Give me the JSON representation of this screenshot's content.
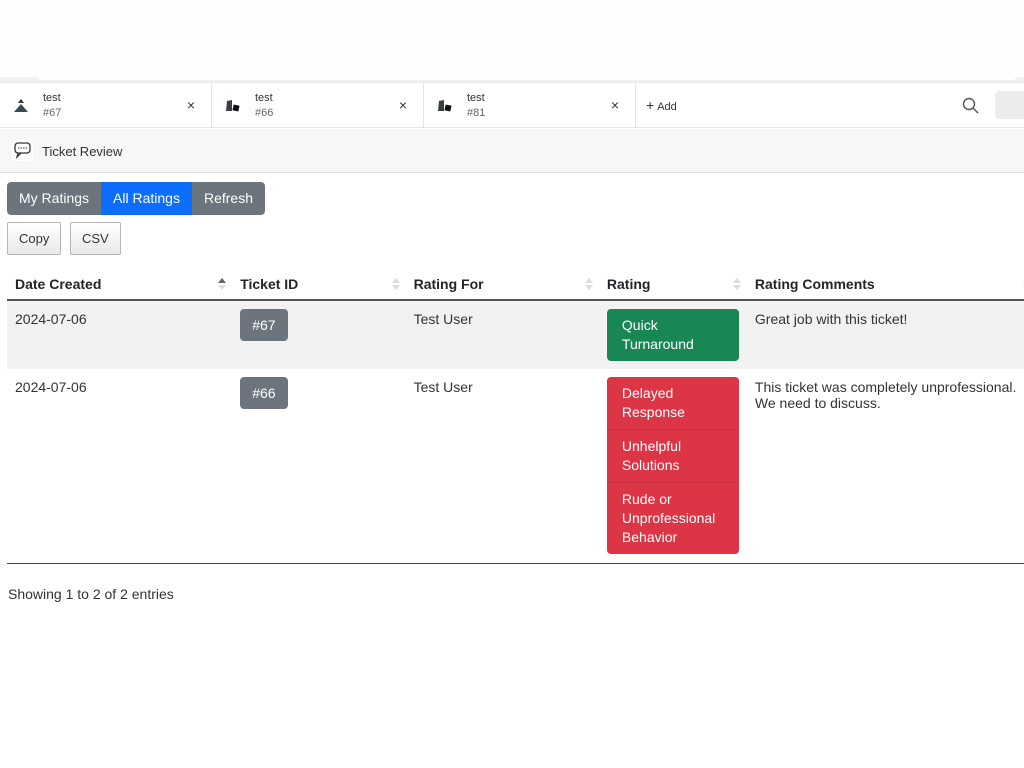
{
  "tabs": [
    {
      "name": "test",
      "number": "#67",
      "icon": "eject-triangle-icon"
    },
    {
      "name": "test",
      "number": "#66",
      "icon": "shapes-icon"
    },
    {
      "name": "test",
      "number": "#81",
      "icon": "shapes-icon"
    }
  ],
  "tabbar": {
    "add_label": "Add",
    "close_glyph": "×"
  },
  "page": {
    "title": "Ticket Review"
  },
  "filters": {
    "my_ratings": "My Ratings",
    "all_ratings": "All Ratings",
    "refresh": "Refresh",
    "active": "All Ratings"
  },
  "export": {
    "copy": "Copy",
    "csv": "CSV"
  },
  "table": {
    "columns": [
      "Date Created",
      "Ticket ID",
      "Rating For",
      "Rating",
      "Rating Comments"
    ],
    "rows": [
      {
        "date": "2024-07-06",
        "ticket": "#67",
        "rating_for": "Test User",
        "ratings": [
          "Quick Turnaround"
        ],
        "rating_type": "positive",
        "comment": "Great job with this ticket!"
      },
      {
        "date": "2024-07-06",
        "ticket": "#66",
        "rating_for": "Test User",
        "ratings": [
          "Delayed Response",
          "Unhelpful Solutions",
          "Rude or Unprofessional Behavior"
        ],
        "rating_type": "negative",
        "comment": "This ticket was completely unprofessional. We need to discuss."
      }
    ]
  },
  "footer": {
    "info": "Showing 1 to 2 of 2 entries"
  },
  "colors": {
    "active_filter": "#0d6efd",
    "secondary": "#6c757d",
    "positive": "#198754",
    "negative": "#dc3545"
  }
}
